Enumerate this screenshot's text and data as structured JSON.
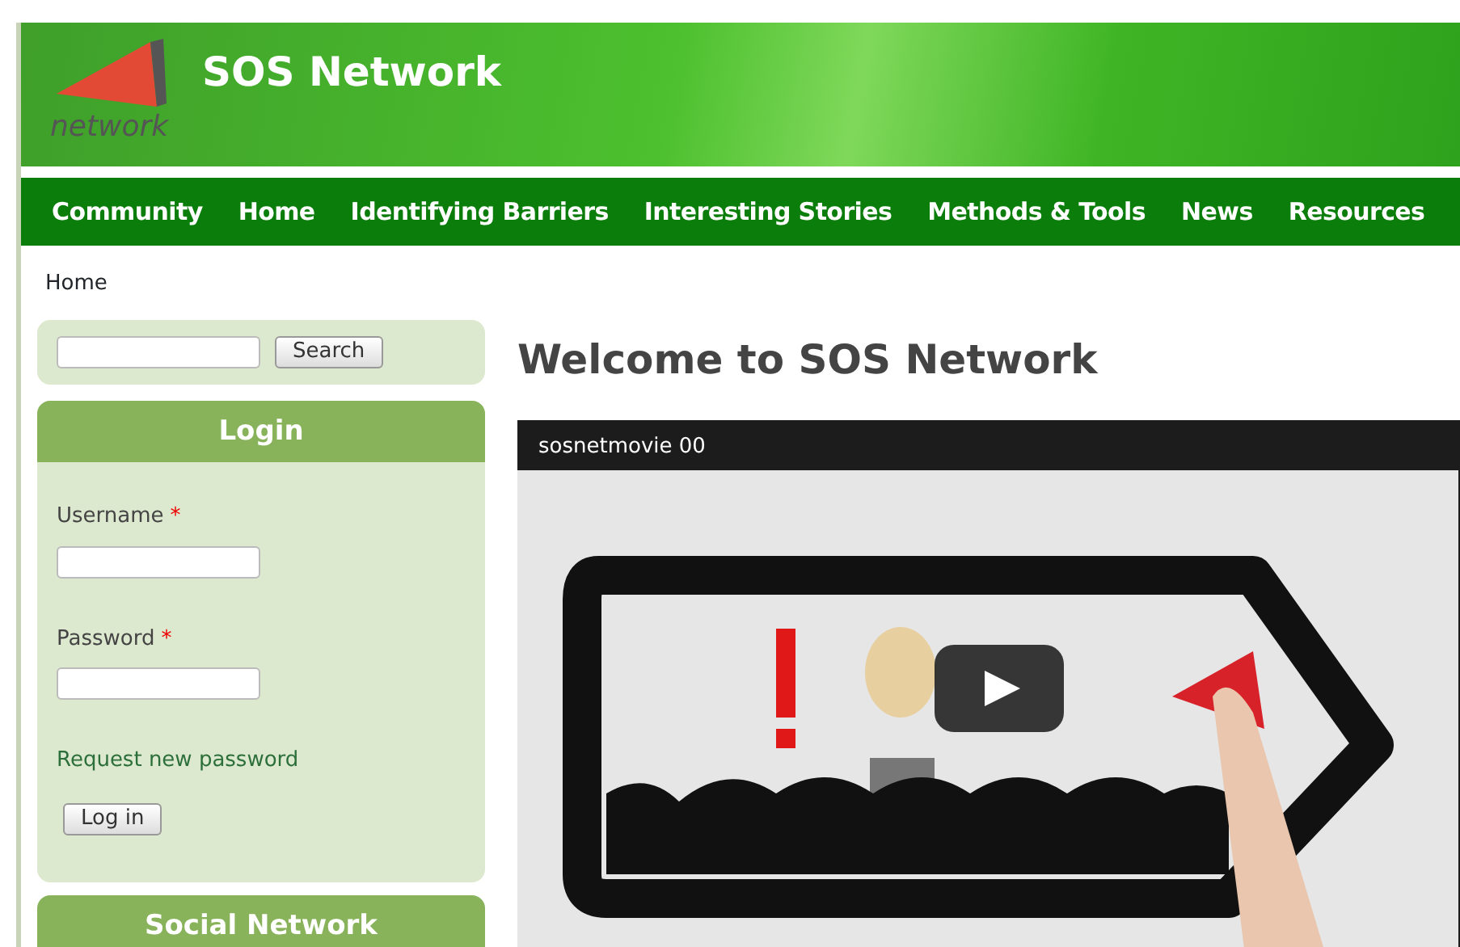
{
  "header": {
    "logo_text": "network",
    "site_name": "SOS Network"
  },
  "nav": [
    {
      "label": "Community"
    },
    {
      "label": "Home"
    },
    {
      "label": "Identifying Barriers"
    },
    {
      "label": "Interesting Stories"
    },
    {
      "label": "Methods & Tools"
    },
    {
      "label": "News"
    },
    {
      "label": "Resources"
    }
  ],
  "breadcrumb": "Home",
  "search": {
    "button": "Search"
  },
  "login": {
    "title": "Login",
    "fields": [
      {
        "label": "Username",
        "required_mark": "*"
      },
      {
        "label": "Password",
        "required_mark": "*"
      }
    ],
    "link": "Request new password",
    "button": "Log in"
  },
  "next_block": {
    "title": "Social Network"
  },
  "main": {
    "heading": "Welcome to SOS Network",
    "video": {
      "title": "sosnetmovie 00"
    }
  }
}
